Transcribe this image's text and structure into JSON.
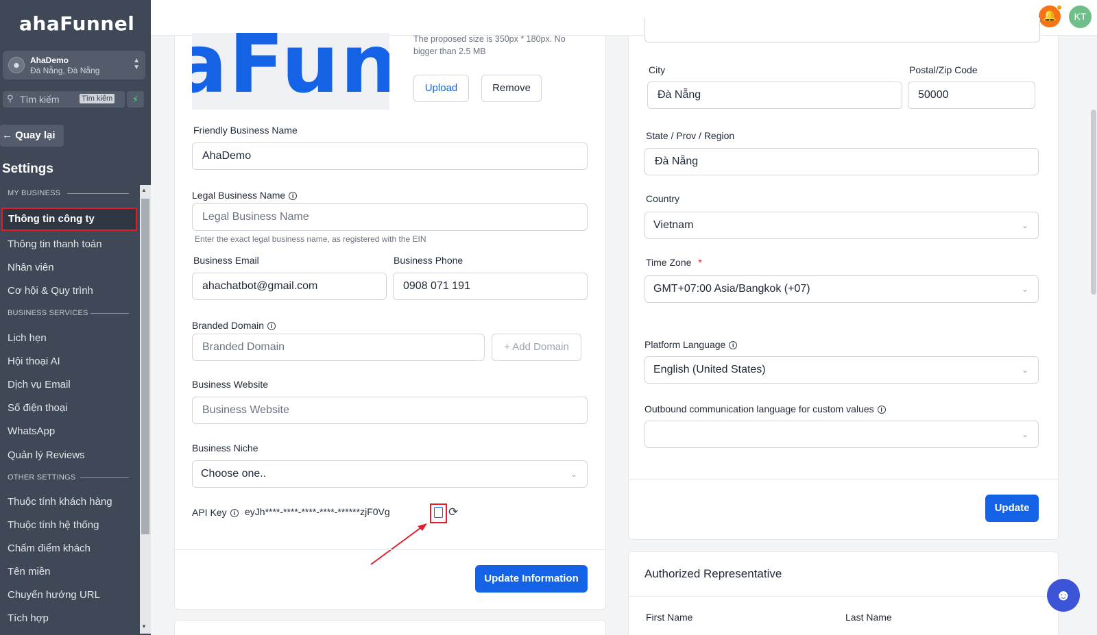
{
  "app": {
    "logo": "ahaFunnel"
  },
  "account": {
    "avatar_icon": "user-icon",
    "name": "AhaDemo",
    "location": "Đà Nẵng, Đà Nẵng"
  },
  "search": {
    "placeholder": "Tìm kiếm",
    "shortcut": "Tìm kiếm"
  },
  "sidebar": {
    "back_label": "Quay lại",
    "title": "Settings",
    "sections": {
      "my_business": "MY BUSINESS",
      "business_services": "BUSINESS SERVICES",
      "other_settings": "OTHER SETTINGS"
    },
    "items": [
      "Thông tin công ty",
      "Thông tin thanh toán",
      "Nhân viên",
      "Cơ hội & Quy trình",
      "Lịch hẹn",
      "Hội thoại AI",
      "Dịch vụ Email",
      "Số điện thoại",
      "WhatsApp",
      "Quản lý Reviews",
      "Thuộc tính khách hàng",
      "Thuộc tính hệ thống",
      "Chấm điểm khách",
      "Tên miền",
      "Chuyển hướng URL",
      "Tích hợp"
    ]
  },
  "header": {
    "avatar_initials": "KT"
  },
  "logo_upload": {
    "preview_text": "aFun",
    "hint": "The proposed size is 350px * 180px. No bigger than 2.5 MB",
    "upload_label": "Upload",
    "remove_label": "Remove"
  },
  "business_form": {
    "friendly_name_label": "Friendly Business Name",
    "friendly_name_value": "AhaDemo",
    "legal_name_label": "Legal Business Name",
    "legal_name_placeholder": "Legal Business Name",
    "legal_name_help": "Enter the exact legal business name, as registered with the EIN",
    "email_label": "Business Email",
    "email_value": "ahachatbot@gmail.com",
    "phone_label": "Business Phone",
    "phone_value": "0908 071 191",
    "domain_label": "Branded Domain",
    "domain_placeholder": "Branded Domain",
    "add_domain_label": "Add Domain",
    "website_label": "Business Website",
    "website_placeholder": "Business Website",
    "niche_label": "Business Niche",
    "niche_value": "Choose one..",
    "api_key_label": "API Key",
    "api_key_value": "eyJh****-****-****-****-******zjF0Vg",
    "update_label": "Update Information"
  },
  "address_form": {
    "city_label": "City",
    "city_value": "Đà Nẵng",
    "zip_label": "Postal/Zip Code",
    "zip_value": "50000",
    "state_label": "State / Prov / Region",
    "state_value": "Đà Nẵng",
    "country_label": "Country",
    "country_value": "Vietnam",
    "timezone_label": "Time Zone",
    "timezone_required": "*",
    "timezone_value": "GMT+07:00 Asia/Bangkok (+07)",
    "platform_lang_label": "Platform Language",
    "platform_lang_value": "English (United States)",
    "outbound_lang_label": "Outbound communication language for custom values",
    "outbound_lang_value": "",
    "update_label": "Update"
  },
  "representative": {
    "title": "Authorized Representative",
    "first_name_label": "First Name",
    "last_name_label": "Last Name"
  },
  "colors": {
    "sidebar": "#3e4856",
    "primary": "#1463e6",
    "highlight": "#e11d2a",
    "bell": "#f97316",
    "avatar": "#6fbf8a"
  }
}
